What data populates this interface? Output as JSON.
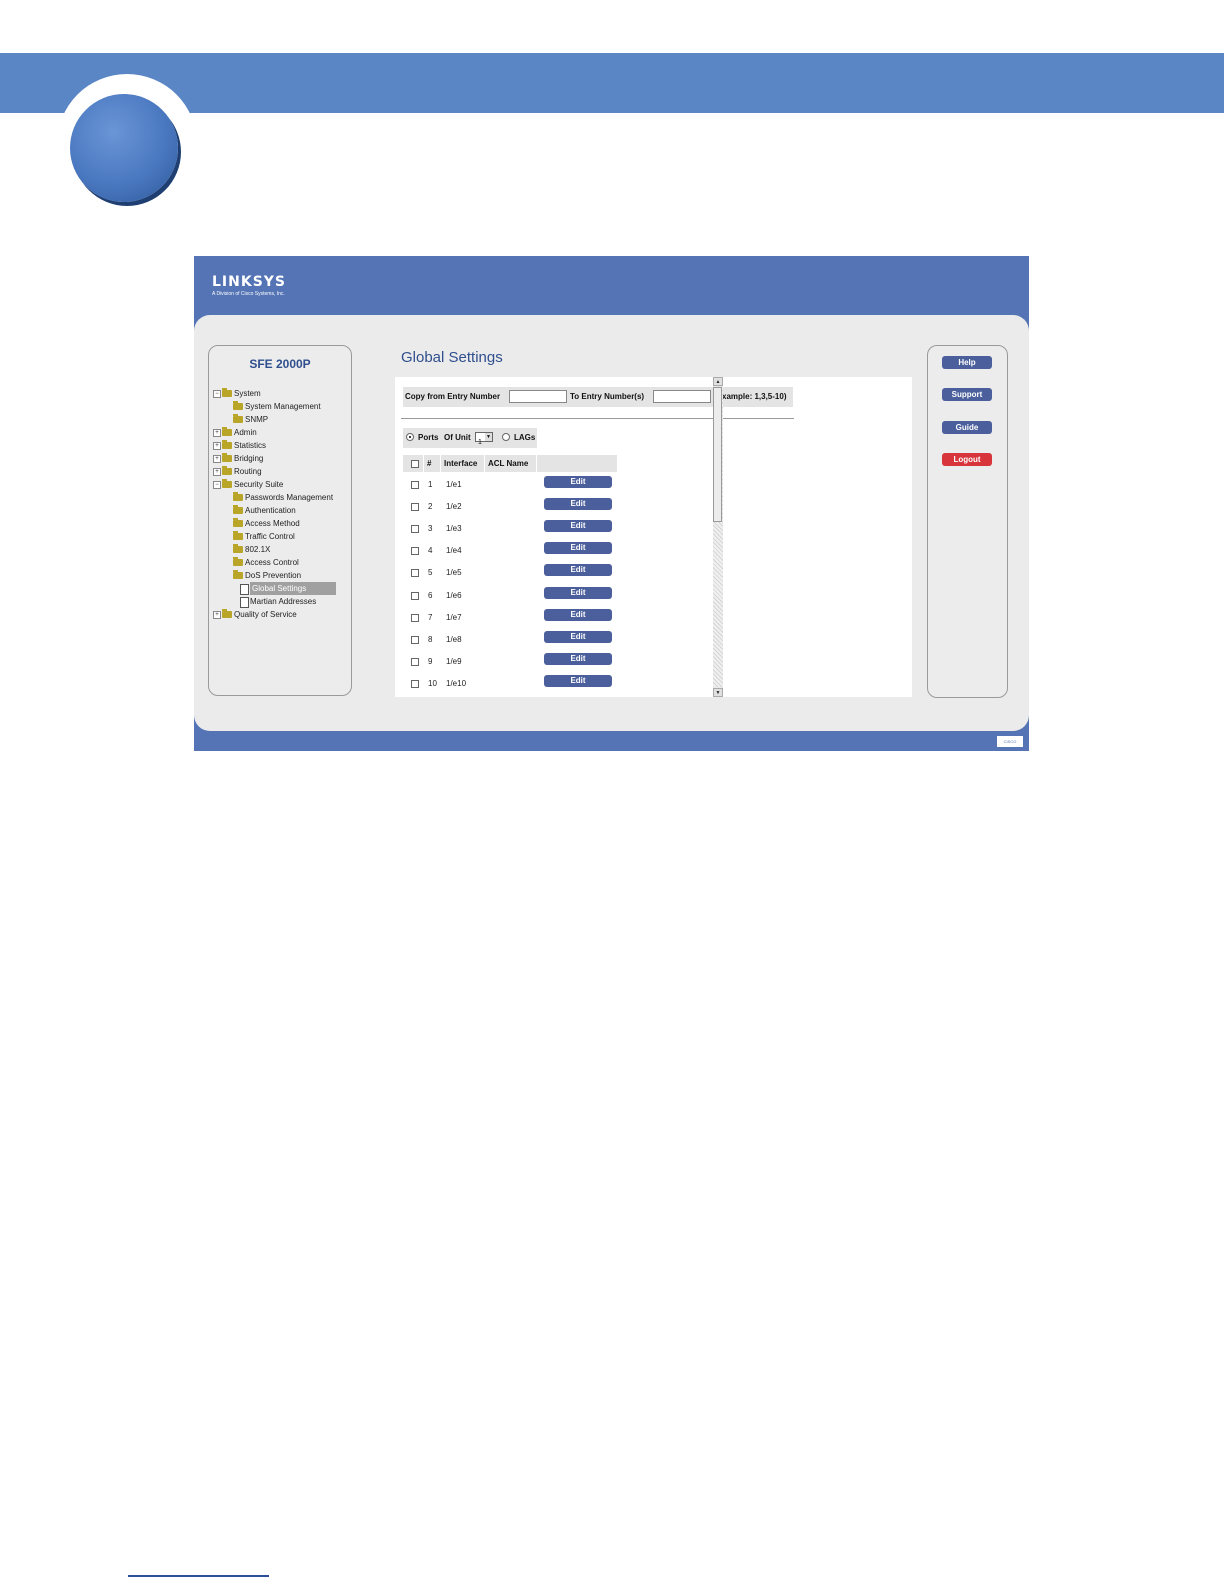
{
  "brand": {
    "name": "LINKSYS",
    "tagline": "A Division of Cisco Systems, Inc."
  },
  "device": "SFE 2000P",
  "nav": [
    {
      "label": "System",
      "level": 0,
      "expander": "−",
      "type": "folder"
    },
    {
      "label": "System Management",
      "level": 1,
      "type": "folder"
    },
    {
      "label": "SNMP",
      "level": 1,
      "type": "folder"
    },
    {
      "label": "Admin",
      "level": 0,
      "expander": "+",
      "type": "folder"
    },
    {
      "label": "Statistics",
      "level": 0,
      "expander": "+",
      "type": "folder"
    },
    {
      "label": "Bridging",
      "level": 0,
      "expander": "+",
      "type": "folder"
    },
    {
      "label": "Routing",
      "level": 0,
      "expander": "+",
      "type": "folder"
    },
    {
      "label": "Security Suite",
      "level": 0,
      "expander": "−",
      "type": "folder"
    },
    {
      "label": "Passwords Management",
      "level": 1,
      "type": "folder"
    },
    {
      "label": "Authentication",
      "level": 1,
      "type": "folder"
    },
    {
      "label": "Access Method",
      "level": 1,
      "type": "folder"
    },
    {
      "label": "Traffic Control",
      "level": 1,
      "type": "folder"
    },
    {
      "label": "802.1X",
      "level": 1,
      "type": "folder"
    },
    {
      "label": "Access Control",
      "level": 1,
      "type": "folder"
    },
    {
      "label": "DoS Prevention",
      "level": 1,
      "type": "folder"
    },
    {
      "label": "Global Settings",
      "level": 2,
      "type": "doc",
      "selected": true
    },
    {
      "label": "Martian Addresses",
      "level": 2,
      "type": "doc"
    },
    {
      "label": "Quality of Service",
      "level": 0,
      "expander": "+",
      "type": "folder"
    }
  ],
  "page_title": "Global Settings",
  "copy": {
    "from_label": "Copy from Entry Number",
    "from_value": "",
    "to_label": "To Entry Number(s)",
    "to_value": "",
    "example": "(Example: 1,3,5-10)"
  },
  "selector": {
    "ports_label": "Ports",
    "unit_label": "Of Unit",
    "unit_value": "1",
    "lags_label": "LAGs",
    "selected": "Ports"
  },
  "table": {
    "headers": {
      "number": "#",
      "interface": "Interface",
      "acl": "ACL Name"
    },
    "rows": [
      {
        "num": "1",
        "iface": "1/e1",
        "acl": ""
      },
      {
        "num": "2",
        "iface": "1/e2",
        "acl": ""
      },
      {
        "num": "3",
        "iface": "1/e3",
        "acl": ""
      },
      {
        "num": "4",
        "iface": "1/e4",
        "acl": ""
      },
      {
        "num": "5",
        "iface": "1/e5",
        "acl": ""
      },
      {
        "num": "6",
        "iface": "1/e6",
        "acl": ""
      },
      {
        "num": "7",
        "iface": "1/e7",
        "acl": ""
      },
      {
        "num": "8",
        "iface": "1/e8",
        "acl": ""
      },
      {
        "num": "9",
        "iface": "1/e9",
        "acl": ""
      },
      {
        "num": "10",
        "iface": "1/e10",
        "acl": ""
      }
    ],
    "edit_label": "Edit"
  },
  "side_buttons": {
    "help": "Help",
    "support": "Support",
    "guide": "Guide",
    "logout": "Logout"
  },
  "colors": {
    "header_blue": "#5474b5",
    "button_blue": "#4a5f9b",
    "logout_red": "#d8343c",
    "doc_band": "#5b86c6"
  }
}
